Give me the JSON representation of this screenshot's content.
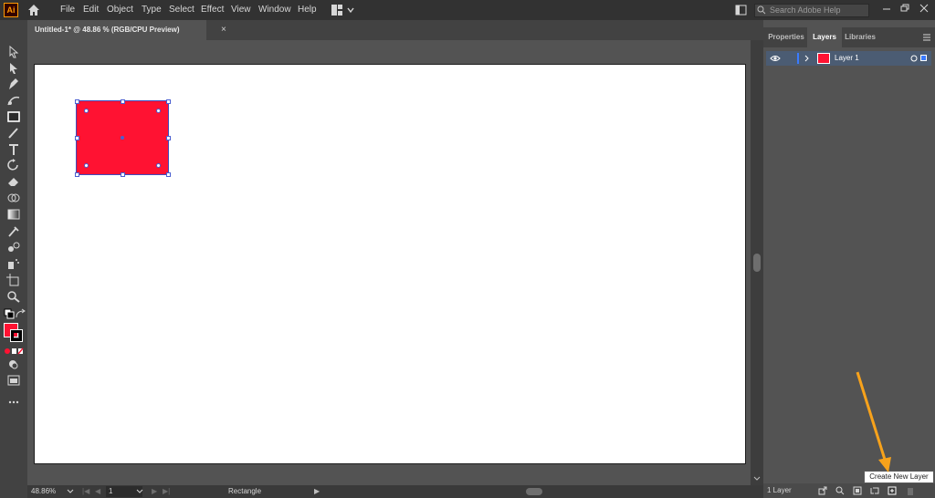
{
  "app": {
    "logo": "Ai"
  },
  "menu": {
    "items": [
      "File",
      "Edit",
      "Object",
      "Type",
      "Select",
      "Effect",
      "View",
      "Window",
      "Help"
    ]
  },
  "search": {
    "placeholder": "Search Adobe Help"
  },
  "document": {
    "tab_title": "Untitled-1* @ 48.86 % (RGB/CPU Preview)",
    "close": "×"
  },
  "status": {
    "zoom": "48.86%",
    "page": "1",
    "tool_name": "Rectangle"
  },
  "panel": {
    "tabs": [
      "Properties",
      "Layers",
      "Libraries"
    ],
    "active_tab": "Layers",
    "layers": [
      {
        "name": "Layer 1",
        "color": "#ff1232"
      }
    ],
    "layer_count": "1 Layer",
    "tooltip": "Create New Layer"
  },
  "colors": {
    "fill": "#ff1232",
    "accent_arrow": "#f7a21b",
    "selection": "#4a5fd0"
  },
  "icons": [
    "home-icon",
    "select-icon",
    "direct-select-icon",
    "pen-icon",
    "curvature-icon",
    "rectangle-icon",
    "brush-icon",
    "type-icon",
    "rotate-icon",
    "eraser-icon",
    "shape-builder-icon",
    "gradient-icon",
    "eyedropper-icon",
    "blend-icon",
    "symbol-sprayer-icon",
    "artboard-icon",
    "zoom-icon",
    "eye-icon",
    "chevron-right-icon",
    "create-new-layer-icon",
    "trash-icon"
  ]
}
